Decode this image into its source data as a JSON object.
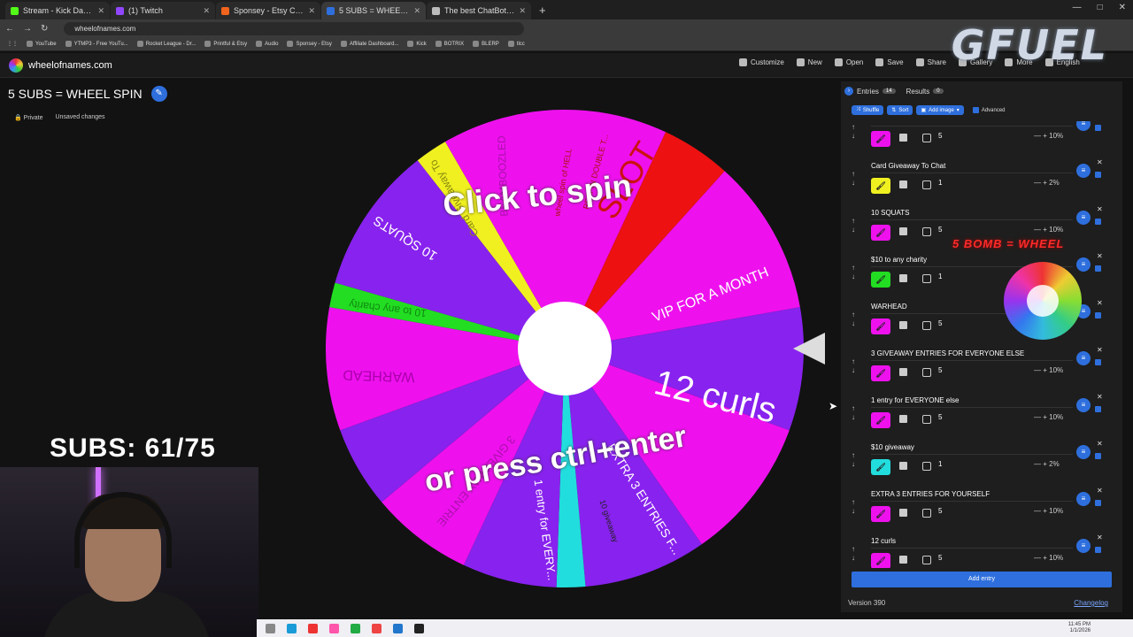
{
  "browser": {
    "tabs": [
      {
        "title": "Stream - Kick Dashboard",
        "color": "#53fc18",
        "active": false
      },
      {
        "title": "(1) Twitch",
        "color": "#9146ff",
        "active": false
      },
      {
        "title": "Sponsey - Etsy Canada",
        "color": "#f1641e",
        "active": false
      },
      {
        "title": "5 SUBS = WHEEL SPIN",
        "color": "#2e6fdd",
        "active": true
      },
      {
        "title": "The best ChatBot and Widgets",
        "color": "#bbbbbb",
        "active": false
      }
    ],
    "newtab": "+",
    "url": "wheelofnames.com",
    "bookmarks": [
      "YouTube",
      "YTMP3 - Free YouTu...",
      "Rocket League - Dr...",
      "Printful & Etsy",
      "Audio",
      "Sponsey - Etsy",
      "Affiliate Dashboard...",
      "Kick",
      "BOTRIX",
      "BLERP",
      "tlcc"
    ]
  },
  "overlay": {
    "gfuel": "GFUEL",
    "subs": "SUBS: 61/75",
    "bomb": "5 BOMB = WHEEL"
  },
  "app": {
    "site_name": "wheelofnames.com",
    "menu": [
      {
        "label": "Customize",
        "icon": "palette-icon"
      },
      {
        "label": "New",
        "icon": "file-icon"
      },
      {
        "label": "Open",
        "icon": "folder-icon"
      },
      {
        "label": "Save",
        "icon": "save-icon"
      },
      {
        "label": "Share",
        "icon": "share-icon"
      },
      {
        "label": "Gallery",
        "icon": "search-icon"
      },
      {
        "label": "More",
        "icon": "more-icon"
      },
      {
        "label": "English",
        "icon": "globe-icon"
      }
    ],
    "wheel_title": "5 SUBS = WHEEL SPIN",
    "private_label": "Private",
    "unsaved_label": "Unsaved changes"
  },
  "wheel": {
    "click_text": "Click to spin",
    "press_text": "or press ctrl+enter",
    "slice_labels": [
      "SLOT",
      "VIP FOR A MONTH",
      "12 curls",
      "EXTRA 3 ENTRIES F...",
      "10 giveaway",
      "1 entry for EVERY...",
      "3 GIVEAWAY ENTRIE",
      "WARHEAD",
      "10 to any charity",
      "10 SQUATS",
      "Card Giveaway To",
      "BEAMBOOZLED",
      "wheel spin of HELL",
      "RESPIN DOUBLE T..."
    ],
    "colors": {
      "magenta": "#ee11ee",
      "purple": "#8822ee",
      "yellow": "#f0f020",
      "green": "#22dd22",
      "red": "#ee1111",
      "cyan": "#22dddd"
    }
  },
  "panel": {
    "tab_entries": "Entries",
    "entries_count": "14",
    "tab_results": "Results",
    "results_count": "0",
    "tools": [
      "Shuffle",
      "Sort",
      "Add image"
    ],
    "advanced_label": "Advanced",
    "entries": [
      {
        "name": "",
        "color": "#ee11ee",
        "weight": "5",
        "pct": "10%"
      },
      {
        "name": "Card Giveaway To Chat",
        "color": "#f0f020",
        "weight": "1",
        "pct": "2%"
      },
      {
        "name": "10 SQUATS",
        "color": "#ee11ee",
        "weight": "5",
        "pct": "10%"
      },
      {
        "name": "$10 to any charity",
        "color": "#22dd22",
        "weight": "1",
        "pct": ""
      },
      {
        "name": "WARHEAD",
        "color": "#ee11ee",
        "weight": "5",
        "pct": ""
      },
      {
        "name": "3 GIVEAWAY ENTRIES FOR EVERYONE ELSE",
        "color": "#ee11ee",
        "weight": "5",
        "pct": "10%"
      },
      {
        "name": "1 entry for EVERYONE else",
        "color": "#ee11ee",
        "weight": "5",
        "pct": "10%"
      },
      {
        "name": "$10 giveaway",
        "color": "#22dddd",
        "weight": "1",
        "pct": "2%"
      },
      {
        "name": "EXTRA 3 ENTRIES FOR YOURSELF",
        "color": "#ee11ee",
        "weight": "5",
        "pct": "10%"
      },
      {
        "name": "12 curls",
        "color": "#ee11ee",
        "weight": "5",
        "pct": "10%"
      }
    ],
    "add_entry": "Add entry",
    "version": "Version 390",
    "changelog": "Changelog"
  },
  "taskbar": {
    "clock_time": "11:45 PM",
    "clock_date": "1/1/2026"
  }
}
